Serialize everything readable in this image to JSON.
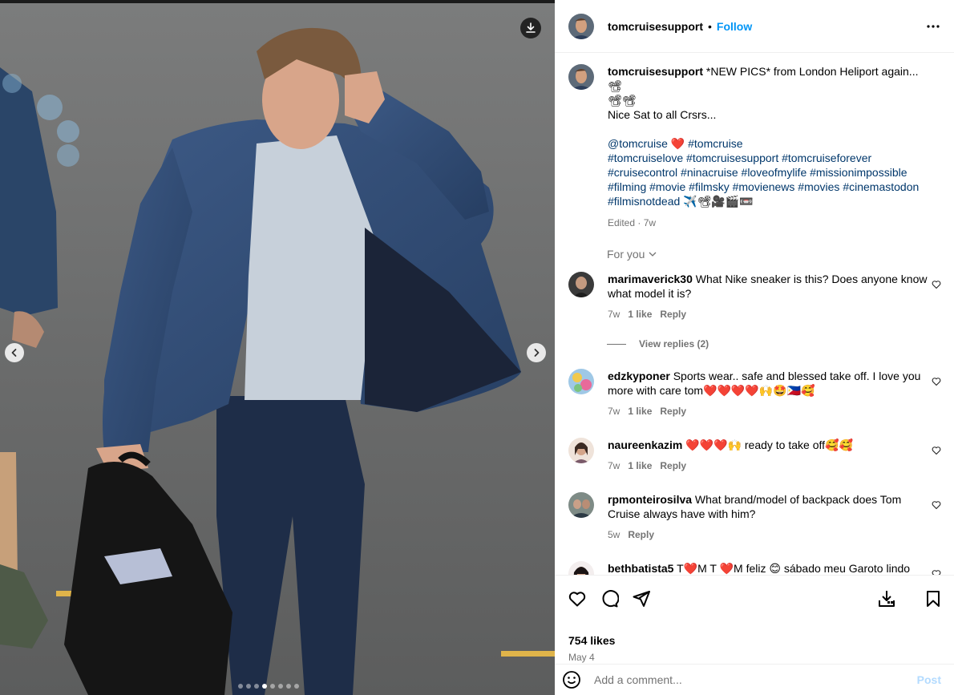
{
  "header": {
    "username": "tomcruisesupport",
    "separator": "•",
    "follow_label": "Follow",
    "more_icon": "more-horizontal-icon"
  },
  "caption": {
    "username": "tomcruisesupport",
    "line1": "*NEW PICS* from London Heliport again...📽",
    "line1b": "📽📽",
    "line2": "Nice Sat to all Crsrs...",
    "mention": "@tomcruise",
    "heart": "❤️",
    "hashtags_line1": "#tomcruise",
    "hashtags_line2": "#tomcruiselove #tomcruisesupport #tomcruiseforever",
    "hashtags_line3": "#cruisecontrol #ninacruise #loveofmylife #missionimpossible",
    "hashtags_line4": "#filming #movie #filmsky #movienews #movies #cinemastodon",
    "hashtags_line5": "#filmisnotdead",
    "trailing_emoji": "✈️📽🎥🎬📼",
    "edited": "Edited",
    "age": "7w"
  },
  "for_you_label": "For you",
  "comments": [
    {
      "username": "marimaverick30",
      "text": "What Nike sneaker is this? Does anyone know what model it is?",
      "age": "7w",
      "likes": "1 like",
      "reply": "Reply",
      "view_replies": "View replies (2)"
    },
    {
      "username": "edzkyponer",
      "text": "Sports wear.. safe and blessed take off. I love you more with care tom❤️❤️❤️❤️🙌🤩🇵🇭🥰",
      "age": "7w",
      "likes": "1 like",
      "reply": "Reply"
    },
    {
      "username": "naureenkazim",
      "text": "❤️❤️❤️🙌 ready to take off🥰🥰",
      "age": "7w",
      "likes": "1 like",
      "reply": "Reply"
    },
    {
      "username": "rpmonteirosilva",
      "text": "What brand/model of backpack does Tom Cruise always have with him?",
      "age": "5w",
      "reply": "Reply"
    },
    {
      "username": "bethbatista5",
      "text": "T❤️M T ❤️M feliz 😊 sábado meu Garoto lindo fofinho ❤️ 😘 BIG BOY 🧑 BEIJINHOS 😘"
    }
  ],
  "actions": {
    "likes": "754 likes",
    "date": "May 4"
  },
  "add_comment": {
    "placeholder": "Add a comment...",
    "post_label": "Post"
  },
  "media": {
    "slide_count": 8,
    "active_slide": 4
  },
  "colors": {
    "accent": "#0095f6",
    "link": "#00376b",
    "muted": "#737373",
    "heart": "#ed4956"
  }
}
